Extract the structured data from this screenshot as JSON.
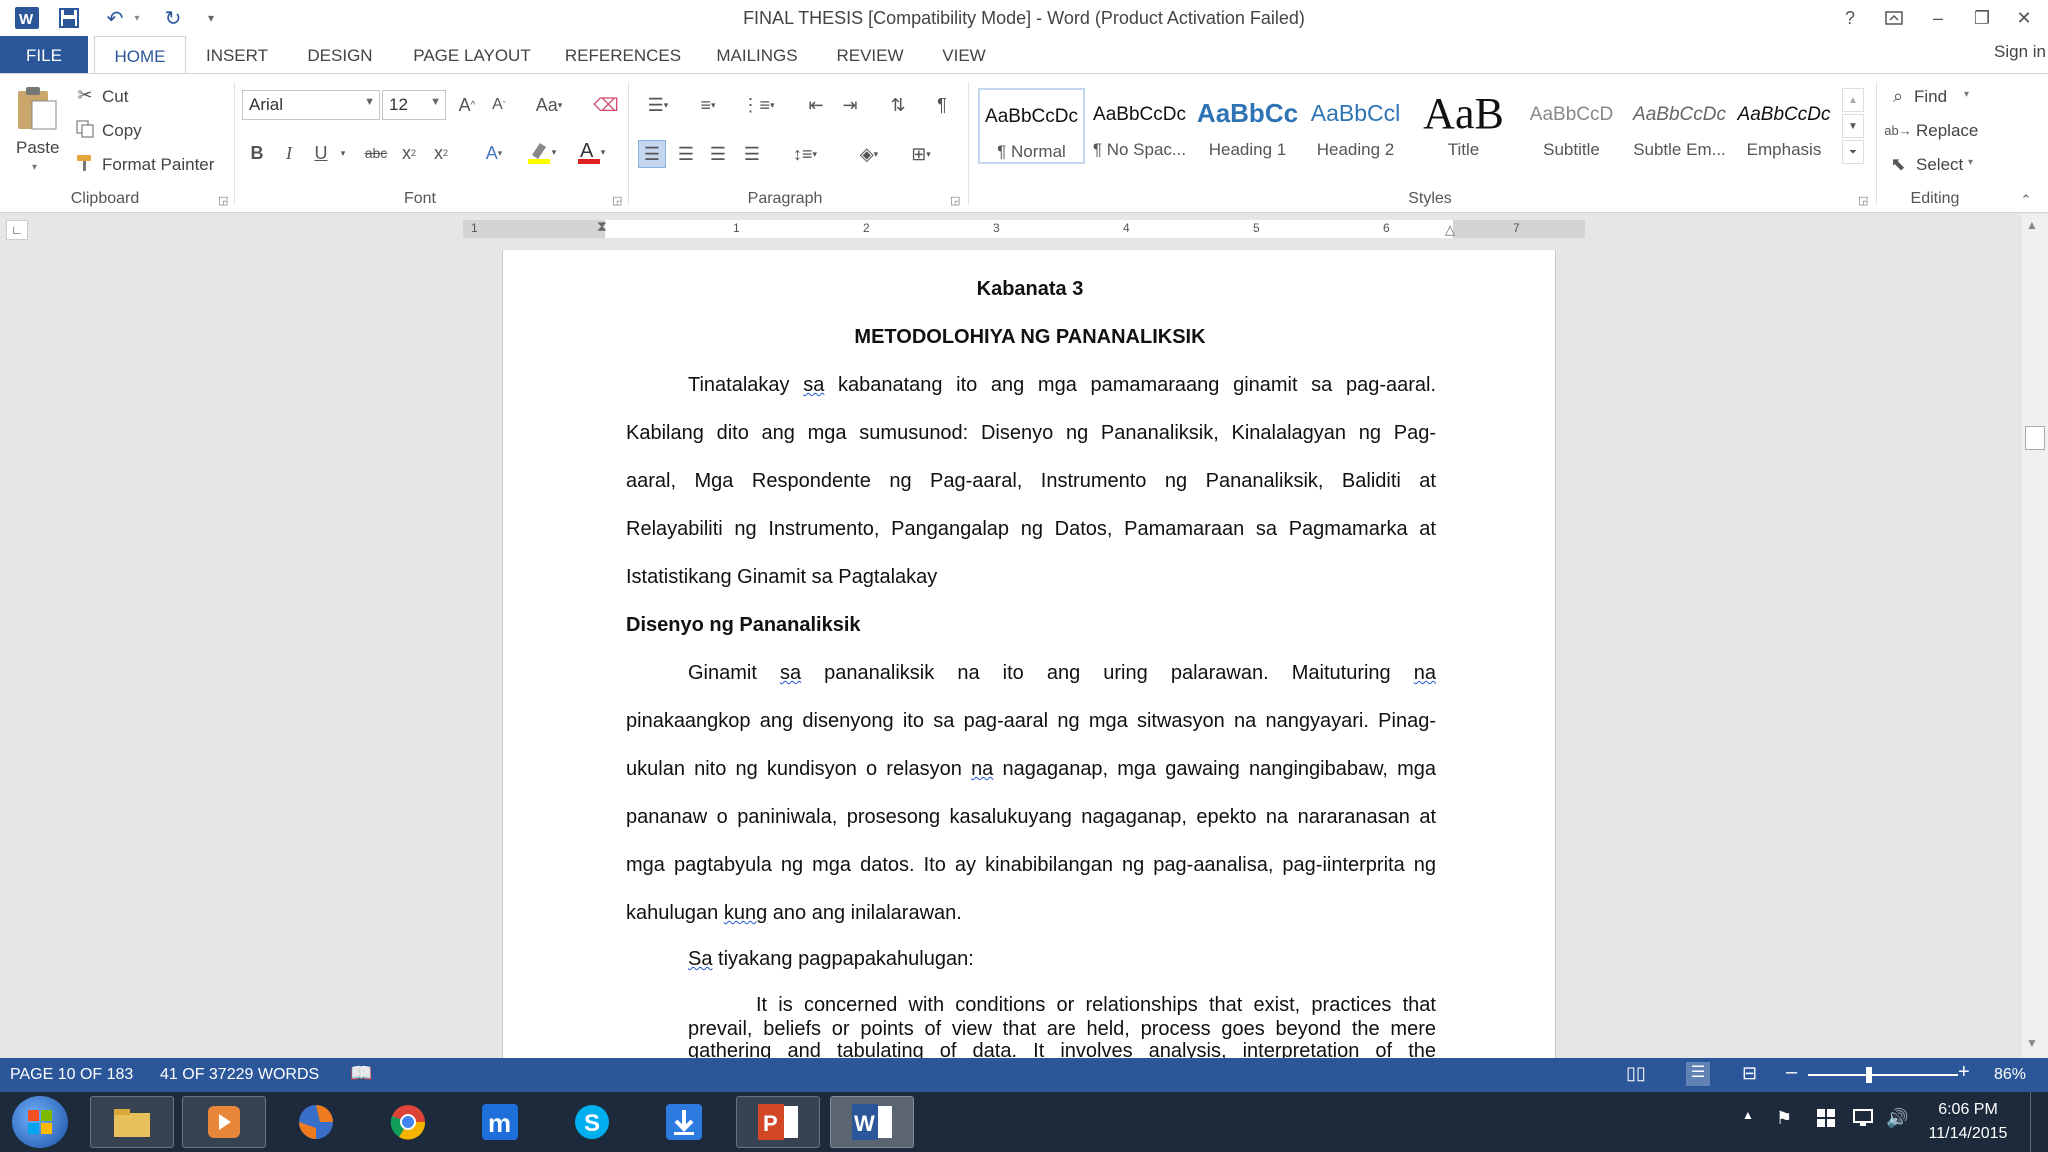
{
  "titlebar": {
    "title": "FINAL THESIS [Compatibility Mode] - Word (Product Activation Failed)",
    "help": "?",
    "minimize": "–",
    "restore": "❐",
    "close": "✕"
  },
  "tabs": {
    "file": "FILE",
    "home": "HOME",
    "insert": "INSERT",
    "design": "DESIGN",
    "page_layout": "PAGE LAYOUT",
    "references": "REFERENCES",
    "mailings": "MAILINGS",
    "review": "REVIEW",
    "view": "VIEW",
    "sign_in": "Sign in"
  },
  "clipboard": {
    "paste": "Paste",
    "cut": "Cut",
    "copy": "Copy",
    "format_painter": "Format Painter",
    "label": "Clipboard"
  },
  "font": {
    "name": "Arial",
    "size": "12",
    "label": "Font"
  },
  "paragraph": {
    "label": "Paragraph"
  },
  "styles": {
    "label": "Styles",
    "items": [
      {
        "sample": "AaBbCcDc",
        "name": "¶ Normal"
      },
      {
        "sample": "AaBbCcDc",
        "name": "¶ No Spac..."
      },
      {
        "sample": "AaBbCc",
        "name": "Heading 1"
      },
      {
        "sample": "AaBbCcl",
        "name": "Heading 2"
      },
      {
        "sample": "AaB",
        "name": "Title"
      },
      {
        "sample": "AaBbCcD",
        "name": "Subtitle"
      },
      {
        "sample": "AaBbCcDc",
        "name": "Subtle Em..."
      },
      {
        "sample": "AaBbCcDc",
        "name": "Emphasis"
      }
    ]
  },
  "editing": {
    "find": "Find",
    "replace": "Replace",
    "select": "Select",
    "label": "Editing"
  },
  "ruler": {
    "numbers": [
      "1",
      "1",
      "2",
      "3",
      "4",
      "5",
      "6",
      "7"
    ]
  },
  "document": {
    "chapter": "Kabanata 3",
    "title": "METODOLOHIYA NG PANANALIKSIK",
    "p1": {
      "l1a": "Tinatalakay ",
      "l1b": "sa",
      "l1c": " kabanatang ito ang mga pamamaraang ginamit sa pag-aaral.",
      "l2": "Kabilang dito ang mga sumusunod: Disenyo ng Pananaliksik, Kinalalagyan ng Pag-",
      "l3": "aaral, Mga Respondente ng Pag-aaral, Instrumento ng Pananaliksik, Baliditi at",
      "l4": "Relayabiliti ng Instrumento, Pangangalap ng Datos, Pamamaraan sa Pagmamarka at",
      "l5": "Istatistikang Ginamit sa Pagtalakay"
    },
    "heading2": "Disenyo ng Pananaliksik",
    "p2": {
      "l1a": "Ginamit ",
      "l1b": "sa",
      "l1c": " pananaliksik na ito ang uring palarawan. Maituturing ",
      "l1d": "na",
      "l2": "pinakaangkop ang disenyong ito sa pag-aaral ng mga sitwasyon na nangyayari. Pinag-",
      "l3a": "ukulan nito ng kundisyon o relasyon ",
      "l3b": "na",
      "l3c": " nagaganap, mga gawaing nangingibabaw, mga",
      "l4": "pananaw o paniniwala, prosesong kasalukuyang nagaganap, epekto na nararanasan at",
      "l5": "mga pagtabyula ng mga datos. Ito ay kinabibilangan ng pag-aanalisa, pag-iinterprita ng",
      "l6a": "kahulugan ",
      "l6b": "kung",
      "l6c": " ano ang inilalarawan."
    },
    "p3": {
      "a": "Sa",
      "b": " tiyakang pagpapakahulugan:"
    },
    "quote": {
      "l1": "It is concerned with conditions or relationships that exist, practices that",
      "l2": "prevail, beliefs or points of view that are held, process goes beyond the mere",
      "l3": "gathering and tabulating of data. It involves analysis, interpretation of the"
    }
  },
  "status": {
    "page": "PAGE 10 OF 183",
    "words": "41 OF 37229 WORDS",
    "zoom": "86%"
  },
  "taskbar": {
    "time": "6:06 PM",
    "date": "11/14/2015"
  }
}
